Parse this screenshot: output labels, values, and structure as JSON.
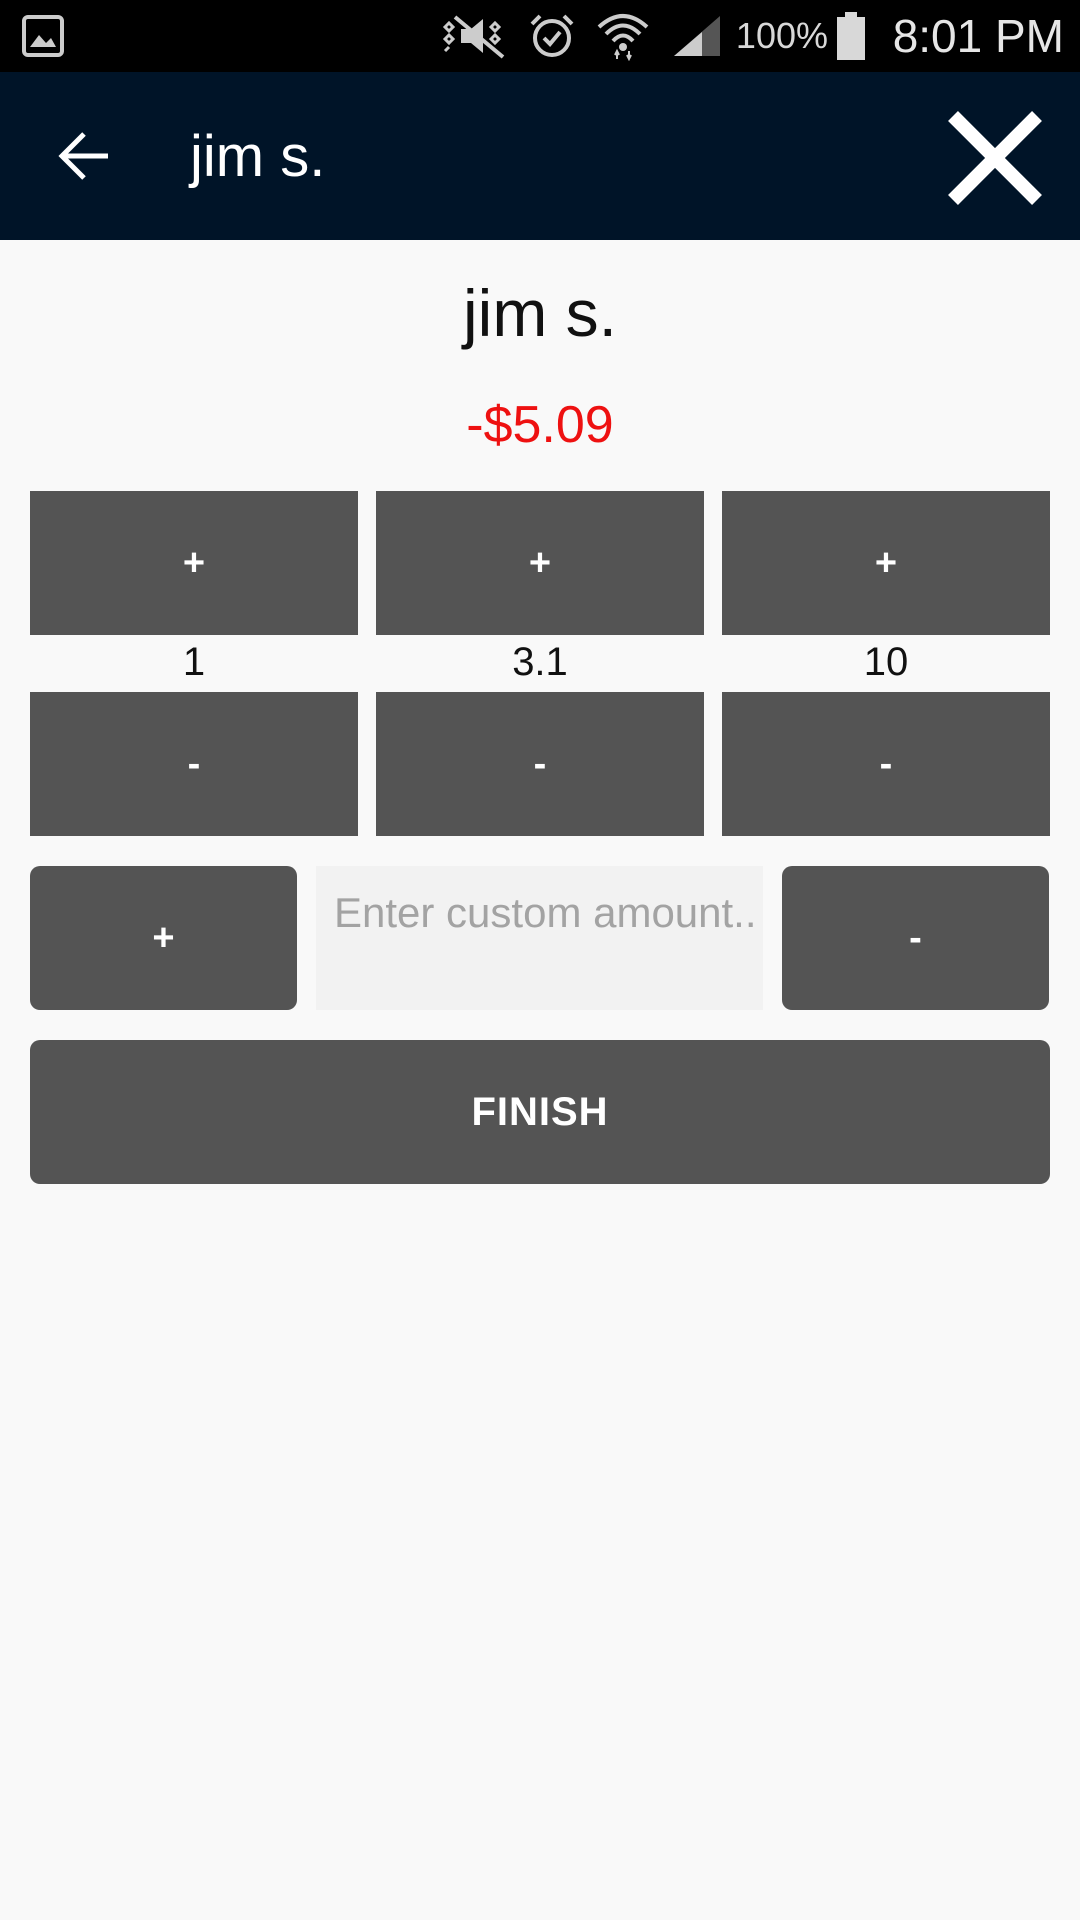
{
  "status_bar": {
    "battery_percent": "100%",
    "time": "8:01 PM",
    "icons": [
      "gallery-icon",
      "mute-icon",
      "alarm-icon",
      "wifi-icon",
      "signal-icon",
      "battery-icon"
    ]
  },
  "app_bar": {
    "title": "jim s.",
    "back_icon": "arrow-left-icon",
    "close_icon": "close-icon"
  },
  "main": {
    "name": "jim s.",
    "balance": "-$5.09",
    "balance_color": "#ee1111",
    "steppers": [
      {
        "plus_label": "+",
        "value": "1",
        "minus_label": "-"
      },
      {
        "plus_label": "+",
        "value": "3.1",
        "minus_label": "-"
      },
      {
        "plus_label": "+",
        "value": "10",
        "minus_label": "-"
      }
    ],
    "custom": {
      "plus_label": "+",
      "minus_label": "-",
      "placeholder": "Enter custom amount..",
      "value": ""
    },
    "finish_label": "FINISH"
  },
  "colors": {
    "app_bar_bg": "#001428",
    "button_bg": "#545454",
    "page_bg": "#f9f9f9"
  }
}
